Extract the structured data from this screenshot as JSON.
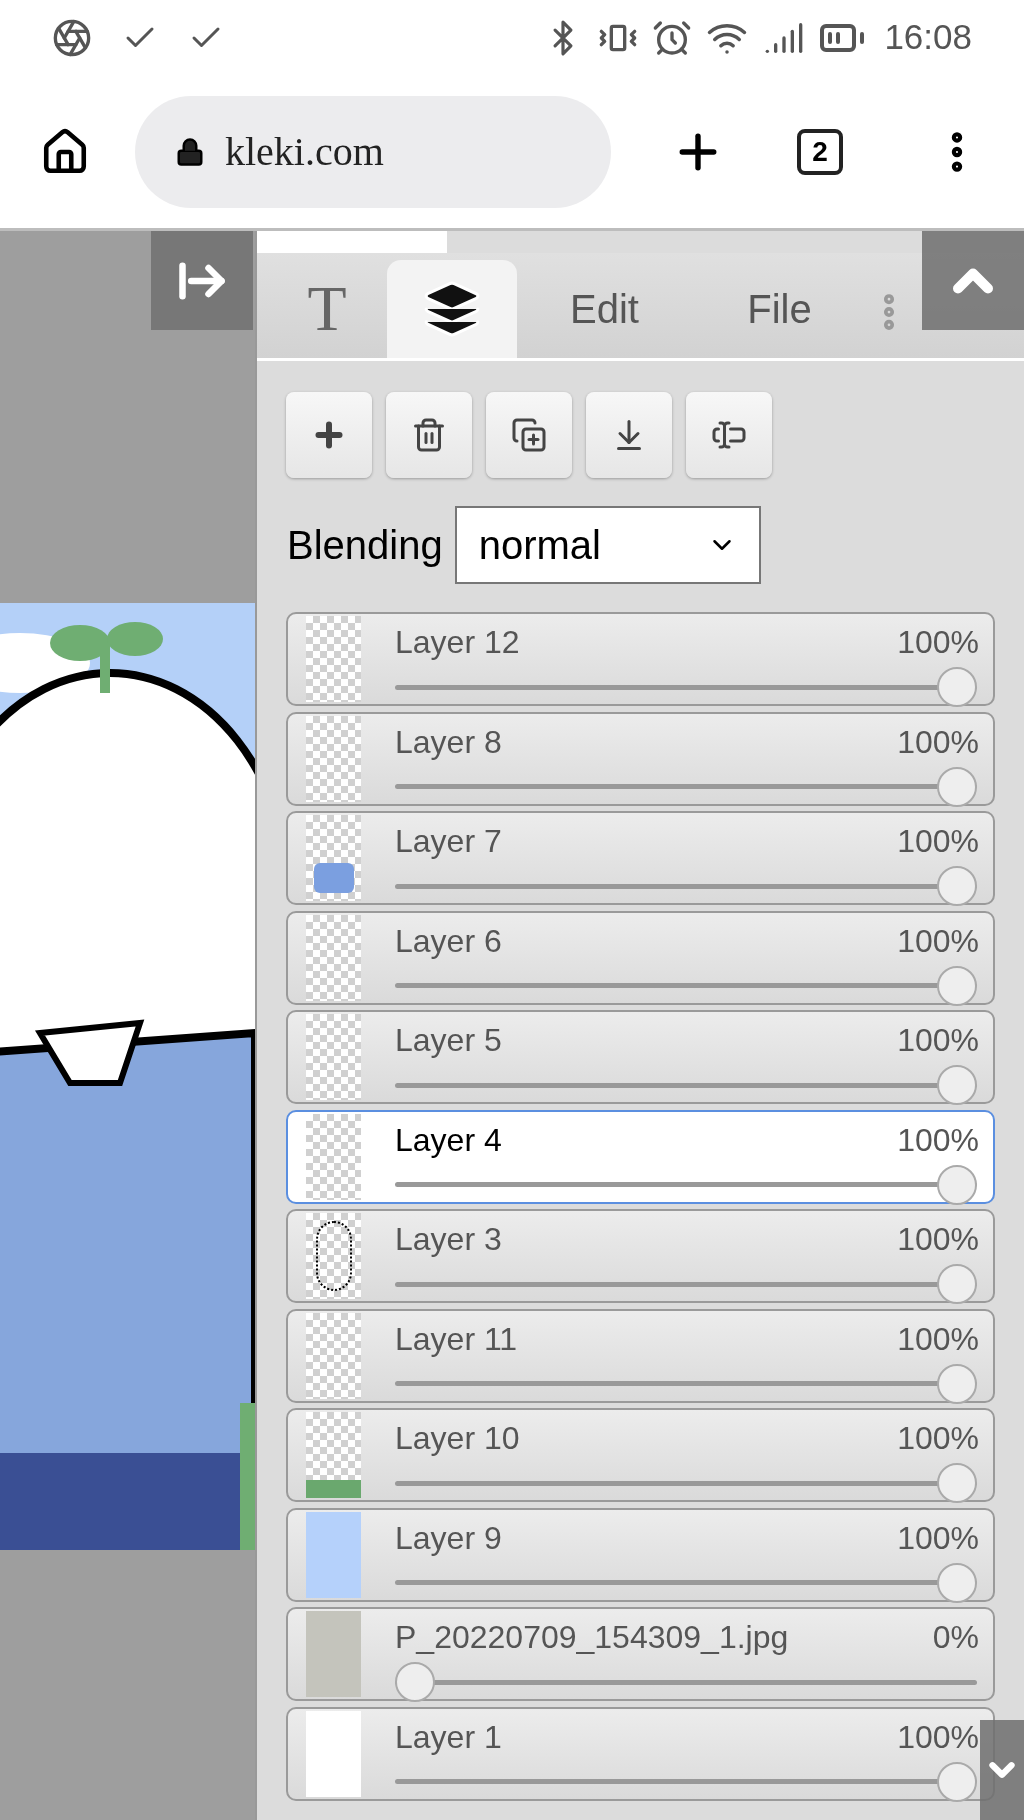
{
  "status_bar": {
    "time": "16:08"
  },
  "browser": {
    "url": "kleki.com",
    "tab_count": "2"
  },
  "tabs": [
    {
      "kind": "text",
      "label": "T",
      "selected": false
    },
    {
      "kind": "layers",
      "selected": true
    },
    {
      "kind": "label",
      "label": "Edit",
      "selected": false
    },
    {
      "kind": "label",
      "label": "File",
      "selected": false
    }
  ],
  "toolbar": [
    {
      "kind": "add"
    },
    {
      "kind": "delete"
    },
    {
      "kind": "duplicate"
    },
    {
      "kind": "merge"
    },
    {
      "kind": "rename"
    }
  ],
  "blending": {
    "label": "Blending",
    "value": "normal"
  },
  "layers": [
    {
      "name": "Layer 12",
      "opacity": "100%",
      "level": 1,
      "selected": false,
      "kind": "transparent"
    },
    {
      "name": "Layer 8",
      "opacity": "100%",
      "level": 1,
      "selected": false,
      "kind": "transparent"
    },
    {
      "name": "Layer 7",
      "opacity": "100%",
      "level": 1,
      "selected": false,
      "kind": "shirt"
    },
    {
      "name": "Layer 6",
      "opacity": "100%",
      "level": 1,
      "selected": false,
      "kind": "transparent"
    },
    {
      "name": "Layer 5",
      "opacity": "100%",
      "level": 1,
      "selected": false,
      "kind": "transparent"
    },
    {
      "name": "Layer 4",
      "opacity": "100%",
      "level": 1,
      "selected": true,
      "kind": "transparent"
    },
    {
      "name": "Layer 3",
      "opacity": "100%",
      "level": 1,
      "selected": false,
      "kind": "sketch"
    },
    {
      "name": "Layer 11",
      "opacity": "100%",
      "level": 1,
      "selected": false,
      "kind": "transparent"
    },
    {
      "name": "Layer 10",
      "opacity": "100%",
      "level": 1,
      "selected": false,
      "kind": "grass"
    },
    {
      "name": "Layer 9",
      "opacity": "100%",
      "level": 1,
      "selected": false,
      "kind": "sky"
    },
    {
      "name": "P_20220709_154309_1.jpg",
      "opacity": "0%",
      "level": 0,
      "selected": false
    },
    {
      "name": "Layer 1",
      "opacity": "100%",
      "level": 1,
      "selected": false,
      "kind": "white"
    }
  ]
}
